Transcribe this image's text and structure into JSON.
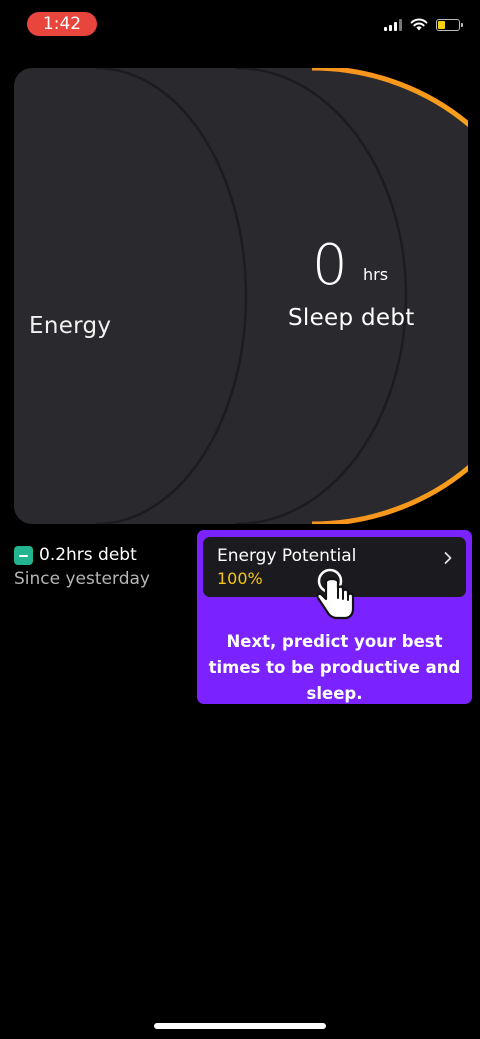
{
  "status_bar": {
    "time": "1:42",
    "battery_level": 0.35,
    "time_pill_color": "#e8453c"
  },
  "energy_card": {
    "energy_label": "Energy",
    "sleep_debt_value": "0",
    "sleep_debt_unit": "hrs",
    "sleep_debt_label": "Sleep debt",
    "arc_gradient": [
      "#f7941d",
      "#f9c80e"
    ]
  },
  "debt_summary": {
    "amount": "0.2hrs debt",
    "since": "Since yesterday",
    "badge_color": "#22b58f",
    "badge_icon": "minus-icon"
  },
  "tutorial": {
    "potential_title": "Energy Potential",
    "potential_value": "100%",
    "chevron_icon": "chevron-right-icon",
    "hand_icon": "tap-hand-icon",
    "message": "Next, predict your best times to be productive and sleep.",
    "background_color": "#7a22ff",
    "value_color": "#f5c518"
  }
}
